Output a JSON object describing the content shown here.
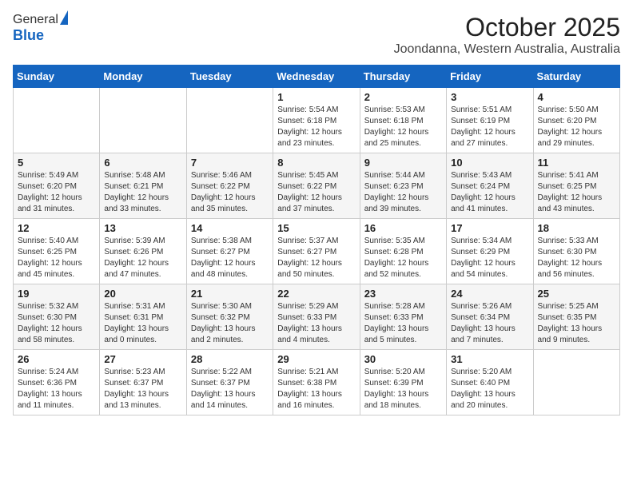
{
  "header": {
    "logo_line1": "General",
    "logo_line2": "Blue",
    "title": "October 2025",
    "subtitle": "Joondanna, Western Australia, Australia"
  },
  "days_of_week": [
    "Sunday",
    "Monday",
    "Tuesday",
    "Wednesday",
    "Thursday",
    "Friday",
    "Saturday"
  ],
  "weeks": [
    [
      {
        "day": "",
        "info": ""
      },
      {
        "day": "",
        "info": ""
      },
      {
        "day": "",
        "info": ""
      },
      {
        "day": "1",
        "info": "Sunrise: 5:54 AM\nSunset: 6:18 PM\nDaylight: 12 hours\nand 23 minutes."
      },
      {
        "day": "2",
        "info": "Sunrise: 5:53 AM\nSunset: 6:18 PM\nDaylight: 12 hours\nand 25 minutes."
      },
      {
        "day": "3",
        "info": "Sunrise: 5:51 AM\nSunset: 6:19 PM\nDaylight: 12 hours\nand 27 minutes."
      },
      {
        "day": "4",
        "info": "Sunrise: 5:50 AM\nSunset: 6:20 PM\nDaylight: 12 hours\nand 29 minutes."
      }
    ],
    [
      {
        "day": "5",
        "info": "Sunrise: 5:49 AM\nSunset: 6:20 PM\nDaylight: 12 hours\nand 31 minutes."
      },
      {
        "day": "6",
        "info": "Sunrise: 5:48 AM\nSunset: 6:21 PM\nDaylight: 12 hours\nand 33 minutes."
      },
      {
        "day": "7",
        "info": "Sunrise: 5:46 AM\nSunset: 6:22 PM\nDaylight: 12 hours\nand 35 minutes."
      },
      {
        "day": "8",
        "info": "Sunrise: 5:45 AM\nSunset: 6:22 PM\nDaylight: 12 hours\nand 37 minutes."
      },
      {
        "day": "9",
        "info": "Sunrise: 5:44 AM\nSunset: 6:23 PM\nDaylight: 12 hours\nand 39 minutes."
      },
      {
        "day": "10",
        "info": "Sunrise: 5:43 AM\nSunset: 6:24 PM\nDaylight: 12 hours\nand 41 minutes."
      },
      {
        "day": "11",
        "info": "Sunrise: 5:41 AM\nSunset: 6:25 PM\nDaylight: 12 hours\nand 43 minutes."
      }
    ],
    [
      {
        "day": "12",
        "info": "Sunrise: 5:40 AM\nSunset: 6:25 PM\nDaylight: 12 hours\nand 45 minutes."
      },
      {
        "day": "13",
        "info": "Sunrise: 5:39 AM\nSunset: 6:26 PM\nDaylight: 12 hours\nand 47 minutes."
      },
      {
        "day": "14",
        "info": "Sunrise: 5:38 AM\nSunset: 6:27 PM\nDaylight: 12 hours\nand 48 minutes."
      },
      {
        "day": "15",
        "info": "Sunrise: 5:37 AM\nSunset: 6:27 PM\nDaylight: 12 hours\nand 50 minutes."
      },
      {
        "day": "16",
        "info": "Sunrise: 5:35 AM\nSunset: 6:28 PM\nDaylight: 12 hours\nand 52 minutes."
      },
      {
        "day": "17",
        "info": "Sunrise: 5:34 AM\nSunset: 6:29 PM\nDaylight: 12 hours\nand 54 minutes."
      },
      {
        "day": "18",
        "info": "Sunrise: 5:33 AM\nSunset: 6:30 PM\nDaylight: 12 hours\nand 56 minutes."
      }
    ],
    [
      {
        "day": "19",
        "info": "Sunrise: 5:32 AM\nSunset: 6:30 PM\nDaylight: 12 hours\nand 58 minutes."
      },
      {
        "day": "20",
        "info": "Sunrise: 5:31 AM\nSunset: 6:31 PM\nDaylight: 13 hours\nand 0 minutes."
      },
      {
        "day": "21",
        "info": "Sunrise: 5:30 AM\nSunset: 6:32 PM\nDaylight: 13 hours\nand 2 minutes."
      },
      {
        "day": "22",
        "info": "Sunrise: 5:29 AM\nSunset: 6:33 PM\nDaylight: 13 hours\nand 4 minutes."
      },
      {
        "day": "23",
        "info": "Sunrise: 5:28 AM\nSunset: 6:33 PM\nDaylight: 13 hours\nand 5 minutes."
      },
      {
        "day": "24",
        "info": "Sunrise: 5:26 AM\nSunset: 6:34 PM\nDaylight: 13 hours\nand 7 minutes."
      },
      {
        "day": "25",
        "info": "Sunrise: 5:25 AM\nSunset: 6:35 PM\nDaylight: 13 hours\nand 9 minutes."
      }
    ],
    [
      {
        "day": "26",
        "info": "Sunrise: 5:24 AM\nSunset: 6:36 PM\nDaylight: 13 hours\nand 11 minutes."
      },
      {
        "day": "27",
        "info": "Sunrise: 5:23 AM\nSunset: 6:37 PM\nDaylight: 13 hours\nand 13 minutes."
      },
      {
        "day": "28",
        "info": "Sunrise: 5:22 AM\nSunset: 6:37 PM\nDaylight: 13 hours\nand 14 minutes."
      },
      {
        "day": "29",
        "info": "Sunrise: 5:21 AM\nSunset: 6:38 PM\nDaylight: 13 hours\nand 16 minutes."
      },
      {
        "day": "30",
        "info": "Sunrise: 5:20 AM\nSunset: 6:39 PM\nDaylight: 13 hours\nand 18 minutes."
      },
      {
        "day": "31",
        "info": "Sunrise: 5:20 AM\nSunset: 6:40 PM\nDaylight: 13 hours\nand 20 minutes."
      },
      {
        "day": "",
        "info": ""
      }
    ]
  ]
}
